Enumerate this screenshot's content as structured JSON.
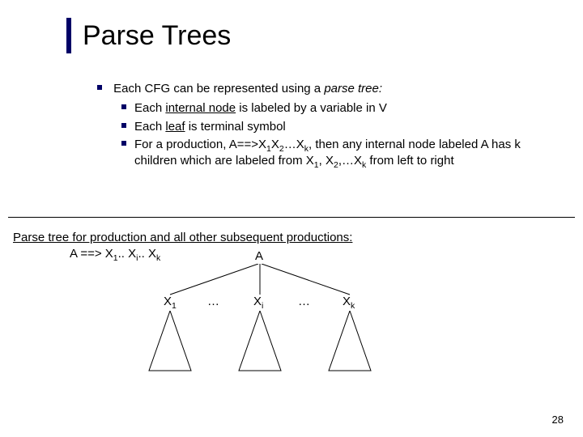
{
  "title": "Parse Trees",
  "bullet_intro_prefix": "Each CFG can be represented using a ",
  "bullet_intro_italic": "parse tree:",
  "sub": {
    "a_pre": "Each ",
    "a_ul": "internal node",
    "a_post": " is labeled by a variable in V",
    "b_pre": "Each ",
    "b_ul": "leaf",
    "b_post": " is terminal symbol",
    "c": "For a production, A==>X₁X₂…X_k, then any internal node labeled A has k children which are labeled from X₁, X₂,…X_k from left to right"
  },
  "second_line1": "Parse tree for production and all other subsequent productions:",
  "second_line2_indent": "A ==> X₁.. Xᵢ.. X_k",
  "tree": {
    "root": "A",
    "c1": "X",
    "c1_sub": "1",
    "c2": "…",
    "c3": "X",
    "c3_sub": "i",
    "c4": "…",
    "c5": "X",
    "c5_sub": "k"
  },
  "page_number": "28"
}
